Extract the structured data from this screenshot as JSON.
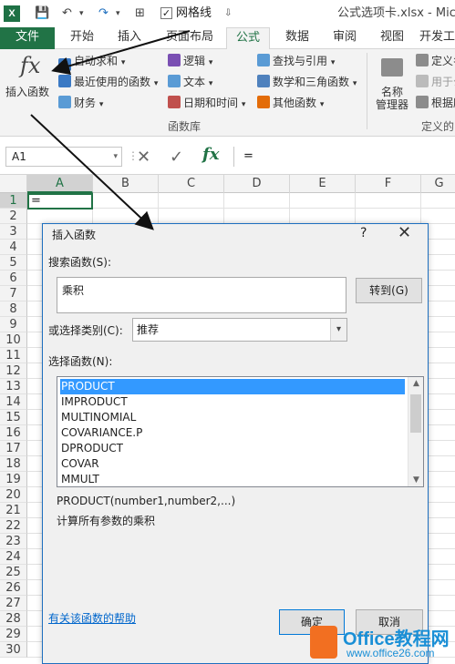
{
  "window": {
    "title": "公式选项卡.xlsx - Micro",
    "gridlines_label": "网格线",
    "gridlines_checked": true
  },
  "tabs": [
    "文件",
    "开始",
    "插入",
    "页面布局",
    "公式",
    "数据",
    "审阅",
    "视图",
    "开发工"
  ],
  "active_tab": "公式",
  "ribbon": {
    "insert_function": "插入函数",
    "function_library": {
      "group_label": "函数库",
      "autosum": "自动求和",
      "recent": "最近使用的函数",
      "financial": "财务",
      "logical": "逻辑",
      "text": "文本",
      "datetime": "日期和时间",
      "lookup": "查找与引用",
      "math": "数学和三角函数",
      "more": "其他函数"
    },
    "defined_names": {
      "name_manager": "名称\n管理器",
      "define_name": "定义名",
      "use_in_formula": "用于公",
      "create_from_selection": "根据所",
      "group_label": "定义的"
    }
  },
  "formula_bar": {
    "name_box": "A1",
    "content": "="
  },
  "grid": {
    "columns": [
      "A",
      "B",
      "C",
      "D",
      "E",
      "F",
      "G"
    ],
    "rows": [
      "1",
      "2",
      "3",
      "4",
      "5",
      "6",
      "7",
      "8",
      "9",
      "10",
      "11",
      "12",
      "13",
      "14",
      "15",
      "16",
      "17",
      "18",
      "19",
      "20",
      "21",
      "22",
      "23",
      "24",
      "25",
      "26",
      "27",
      "28",
      "29",
      "30"
    ],
    "a1_value": "="
  },
  "dialog": {
    "title": "插入函数",
    "help": "?",
    "close": "✕",
    "search_label": "搜索函数(S):",
    "search_value": "乘积",
    "goto_button": "转到(G)",
    "category_label": "或选择类别(C):",
    "category_value": "推荐",
    "select_label": "选择函数(N):",
    "functions": [
      "PRODUCT",
      "IMPRODUCT",
      "MULTINOMIAL",
      "COVARIANCE.P",
      "DPRODUCT",
      "COVAR",
      "MMULT"
    ],
    "selected_function": "PRODUCT",
    "syntax": "PRODUCT(number1,number2,...)",
    "description": "计算所有参数的乘积",
    "help_link": "有关该函数的帮助",
    "ok_button": "确定",
    "cancel_button": "取消"
  },
  "watermark": {
    "brand": "Office教程网",
    "url": "www.office26.com"
  },
  "colors": {
    "excel_green": "#217346",
    "selection_blue": "#3399ff",
    "link_blue": "#0066cc",
    "watermark_orange": "#f26f21"
  }
}
